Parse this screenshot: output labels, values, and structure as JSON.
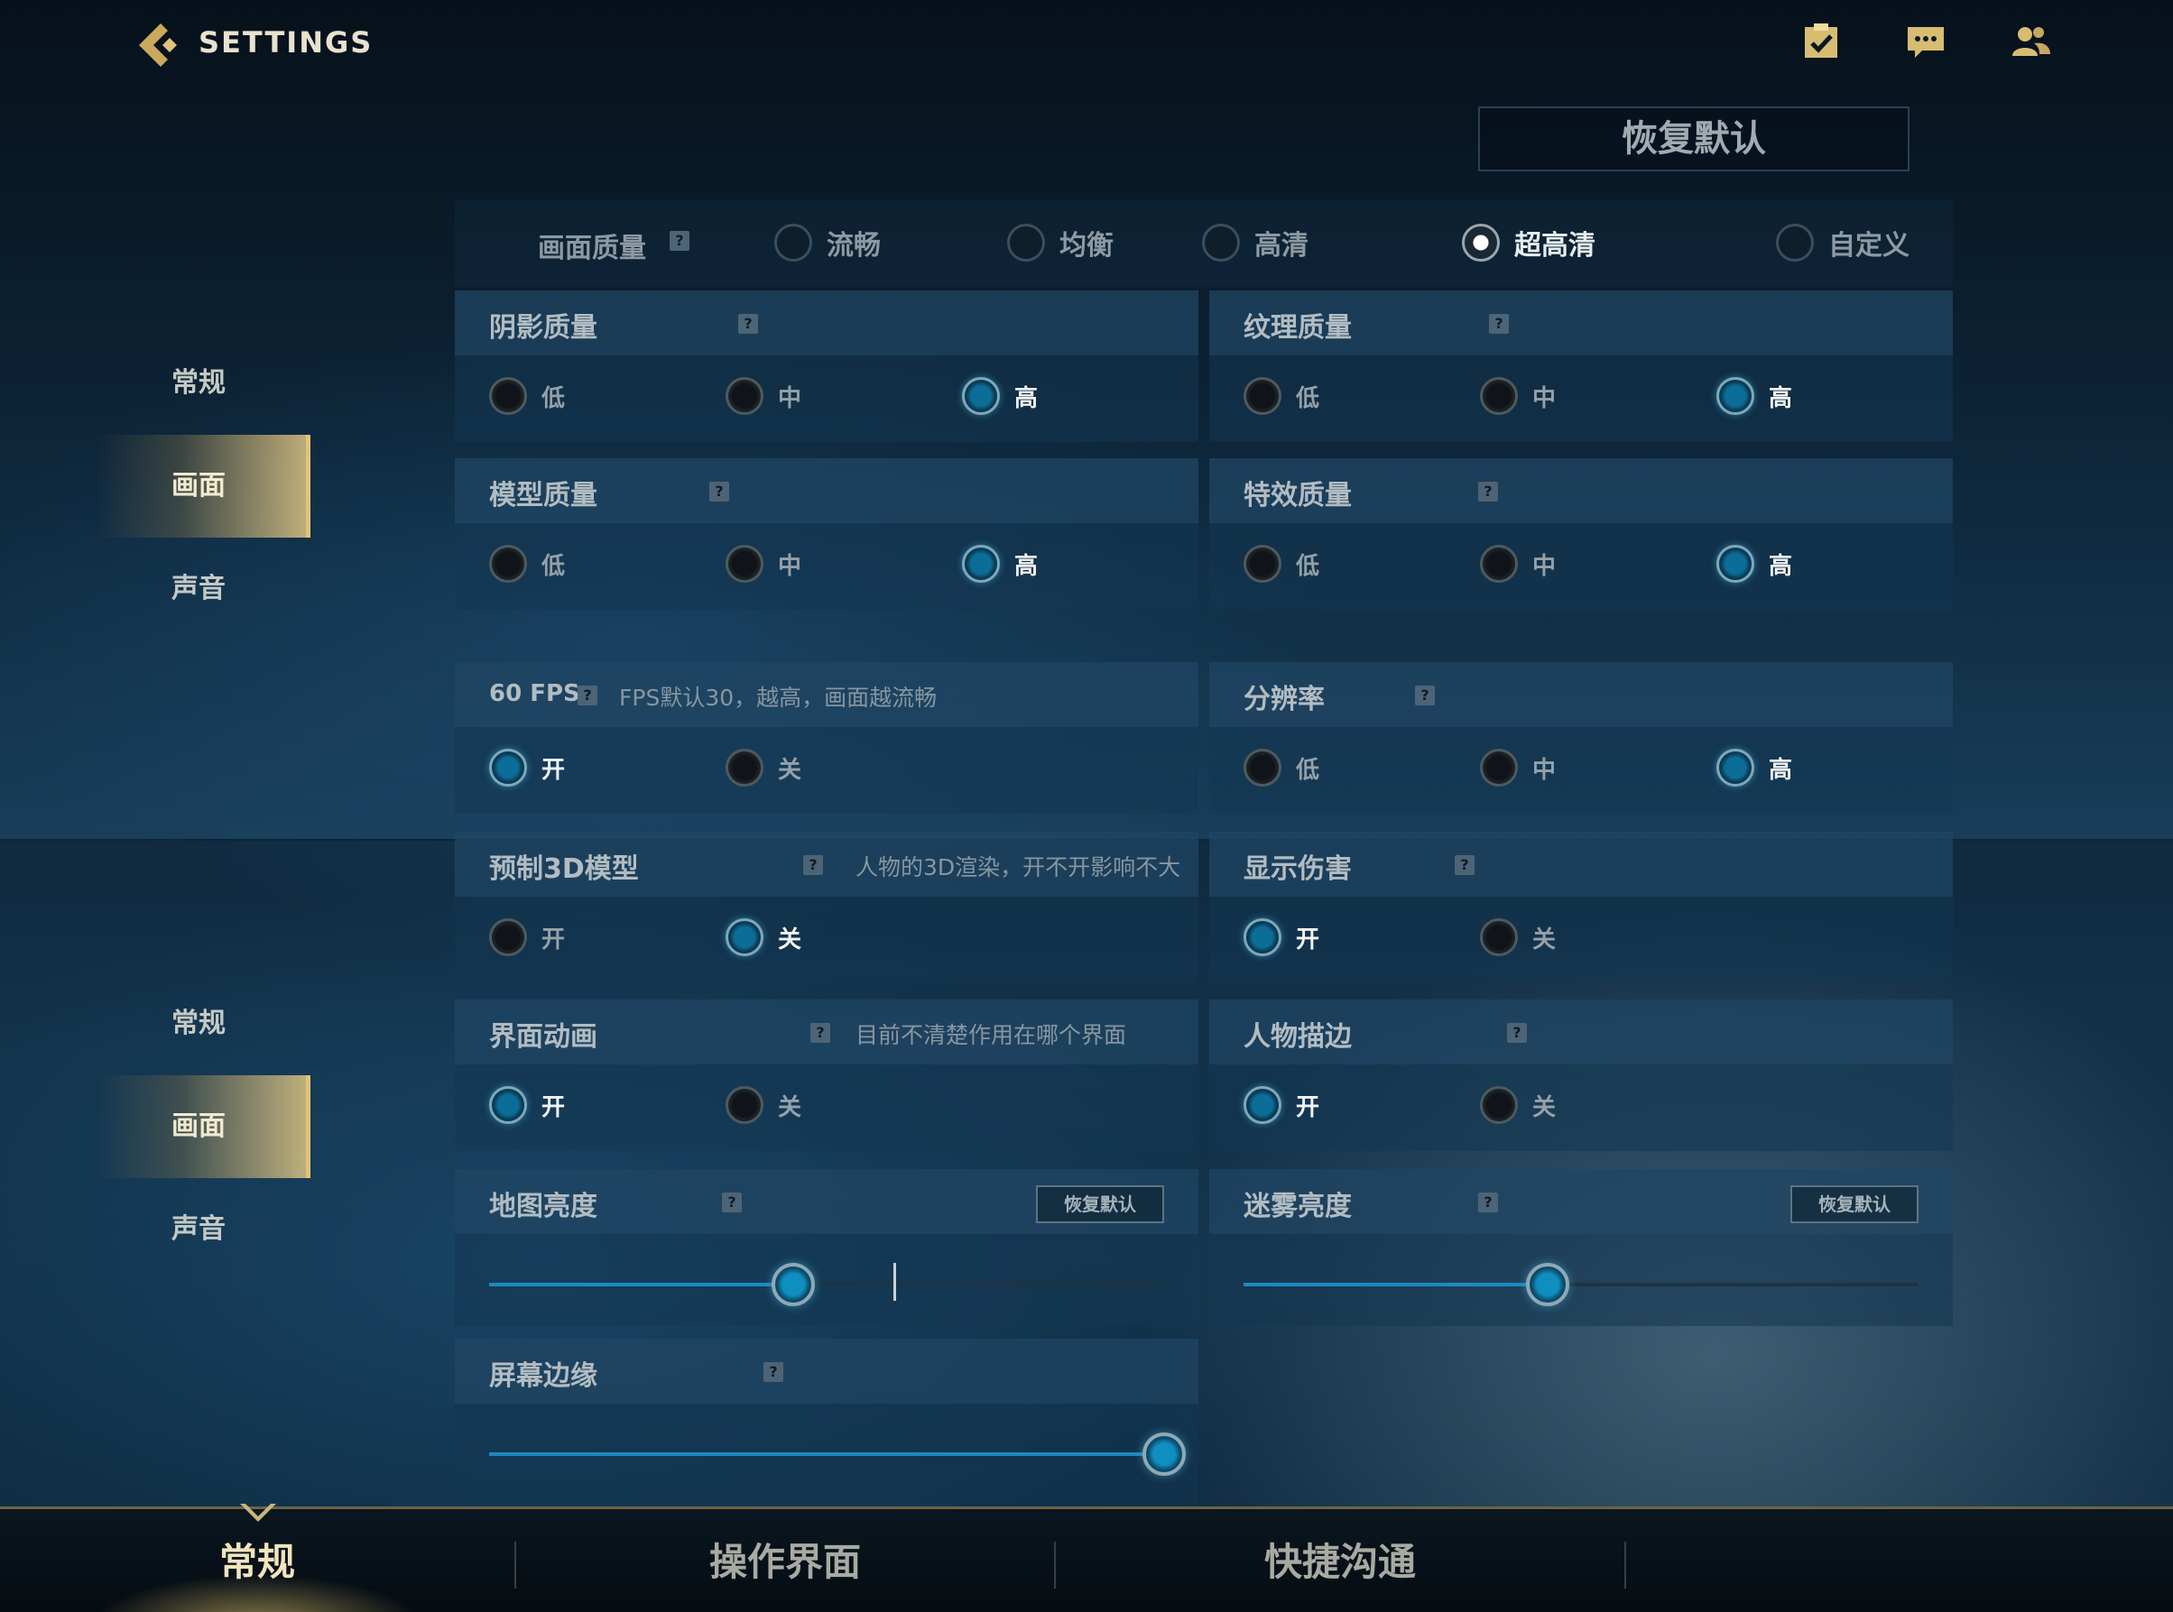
{
  "header": {
    "title": "SETTINGS",
    "icons": [
      "checklist-icon",
      "chat-icon",
      "friends-icon"
    ]
  },
  "reset_default": "恢复默认",
  "side_nav_top": [
    "常规",
    "画面",
    "声音"
  ],
  "side_nav_bottom": [
    "常规",
    "画面",
    "声音"
  ],
  "side_active": "画面",
  "quality": {
    "label": "画面质量",
    "help": "?",
    "options": [
      "流畅",
      "均衡",
      "高清",
      "超高清",
      "自定义"
    ],
    "selected": "超高清"
  },
  "panels": {
    "shadow": {
      "title": "阴影质量",
      "options": [
        "低",
        "中",
        "高"
      ],
      "selected": "高"
    },
    "texture": {
      "title": "纹理质量",
      "options": [
        "低",
        "中",
        "高"
      ],
      "selected": "高"
    },
    "model": {
      "title": "模型质量",
      "options": [
        "低",
        "中",
        "高"
      ],
      "selected": "高"
    },
    "effect": {
      "title": "特效质量",
      "options": [
        "低",
        "中",
        "高"
      ],
      "selected": "高"
    },
    "fps": {
      "title": "60 FPS",
      "note": "FPS默认30，越高，画面越流畅",
      "options": [
        "开",
        "关"
      ],
      "selected": "开"
    },
    "resolution": {
      "title": "分辨率",
      "options": [
        "低",
        "中",
        "高"
      ],
      "selected": "高"
    },
    "preload3d": {
      "title": "预制3D模型",
      "note": "人物的3D渲染，开不开影响不大",
      "options": [
        "开",
        "关"
      ],
      "selected": "关"
    },
    "damage": {
      "title": "显示伤害",
      "options": [
        "开",
        "关"
      ],
      "selected": "开"
    },
    "ui_anim": {
      "title": "界面动画",
      "note": "目前不清楚作用在哪个界面",
      "options": [
        "开",
        "关"
      ],
      "selected": "开"
    },
    "outline": {
      "title": "人物描边",
      "options": [
        "开",
        "关"
      ],
      "selected": "开"
    },
    "map_brightness": {
      "title": "地图亮度",
      "reset": "恢复默认",
      "value": 0.45
    },
    "fog_brightness": {
      "title": "迷雾亮度",
      "reset": "恢复默认",
      "value": 0.45
    },
    "screen_edge": {
      "title": "屏幕边缘",
      "value": 1.0
    }
  },
  "bottom_tabs": [
    "常规",
    "操作界面",
    "快捷沟通"
  ],
  "bottom_active": "常规",
  "colors": {
    "accent_gold": "#e0c47a",
    "accent_blue": "#1e89c0",
    "panel": "#1a3a55"
  }
}
